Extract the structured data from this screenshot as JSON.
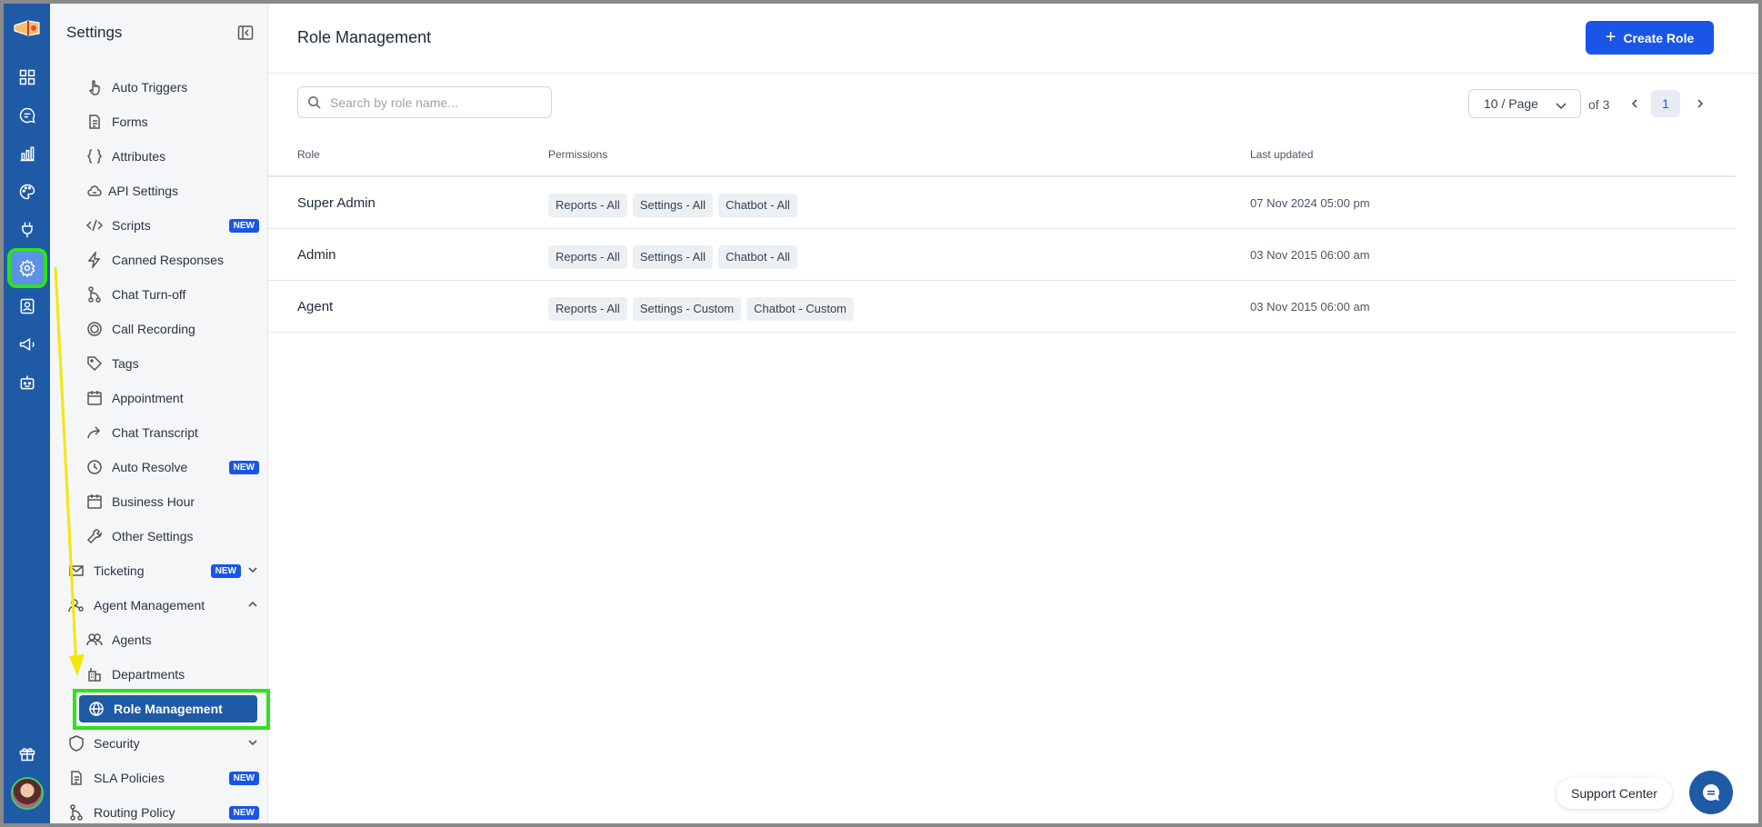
{
  "sidebar": {
    "title": "Settings",
    "items": [
      {
        "label": "Auto Triggers",
        "icon": "hand-pointer-icon"
      },
      {
        "label": "Forms",
        "icon": "document-icon"
      },
      {
        "label": "Attributes",
        "icon": "braces-icon"
      },
      {
        "label": "API Settings",
        "icon": "cloud-icon"
      },
      {
        "label": "Scripts",
        "icon": "code-icon",
        "badge": "NEW"
      },
      {
        "label": "Canned Responses",
        "icon": "lightning-icon"
      },
      {
        "label": "Chat Turn-off",
        "icon": "git-branch-icon"
      },
      {
        "label": "Call Recording",
        "icon": "record-icon"
      },
      {
        "label": "Tags",
        "icon": "tag-icon"
      },
      {
        "label": "Appointment",
        "icon": "calendar-icon"
      },
      {
        "label": "Chat Transcript",
        "icon": "share-arrow-icon"
      },
      {
        "label": "Auto Resolve",
        "icon": "clock-icon",
        "badge": "NEW"
      },
      {
        "label": "Business Hour",
        "icon": "calendar-icon"
      },
      {
        "label": "Other Settings",
        "icon": "wrench-icon"
      }
    ],
    "ticketing": {
      "label": "Ticketing",
      "badge": "NEW"
    },
    "agent_management": {
      "label": "Agent Management"
    },
    "agents": {
      "label": "Agents"
    },
    "departments": {
      "label": "Departments"
    },
    "role_management": {
      "label": "Role Management"
    },
    "security": {
      "label": "Security"
    },
    "sla_policies": {
      "label": "SLA Policies",
      "badge": "NEW"
    },
    "routing_policy": {
      "label": "Routing Policy",
      "badge": "NEW"
    }
  },
  "main": {
    "title": "Role Management",
    "create_button": "Create Role",
    "search_placeholder": "Search by role name...",
    "page_size": "10 / Page",
    "of_pages": "of 3",
    "current_page": "1",
    "columns": [
      "Role",
      "Permissions",
      "Last updated"
    ],
    "rows": [
      {
        "role": "Super Admin",
        "permissions": [
          "Reports - All",
          "Settings - All",
          "Chatbot - All"
        ],
        "updated": "07 Nov 2024 05:00 pm"
      },
      {
        "role": "Admin",
        "permissions": [
          "Reports - All",
          "Settings - All",
          "Chatbot - All"
        ],
        "updated": "03 Nov 2015 06:00 am"
      },
      {
        "role": "Agent",
        "permissions": [
          "Reports - All",
          "Settings - Custom",
          "Chatbot - Custom"
        ],
        "updated": "03 Nov 2015 06:00 am"
      }
    ]
  },
  "support": {
    "label": "Support Center"
  },
  "colors": {
    "rail": "#1f5aa6",
    "accent": "#1a55e8",
    "highlight": "#2fe21b",
    "annotation_arrow": "#f5e60a"
  }
}
